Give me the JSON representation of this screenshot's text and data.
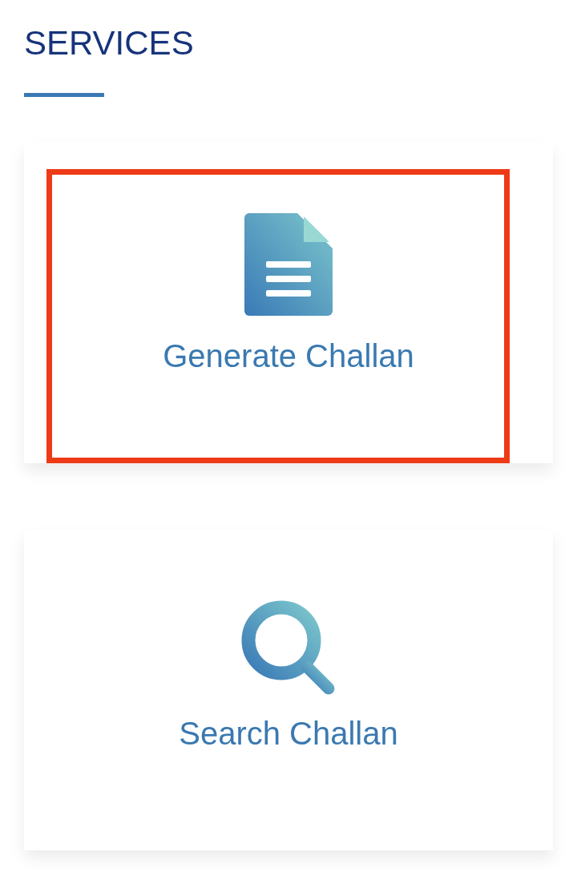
{
  "header": {
    "title": "SERVICES"
  },
  "services": [
    {
      "kind": "document",
      "label": "Generate Challan",
      "highlighted": true
    },
    {
      "kind": "search",
      "label": "Search Challan",
      "highlighted": false
    }
  ]
}
